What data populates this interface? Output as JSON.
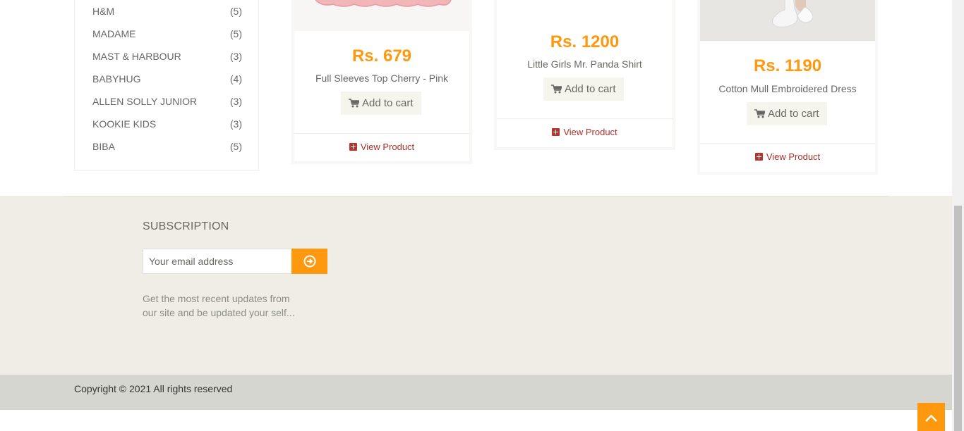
{
  "brands": [
    {
      "name": "H&M",
      "count": "(5)"
    },
    {
      "name": "MADAME",
      "count": "(5)"
    },
    {
      "name": "MAST & HARBOUR",
      "count": "(3)"
    },
    {
      "name": "BABYHUG",
      "count": "(4)"
    },
    {
      "name": "ALLEN SOLLY JUNIOR",
      "count": "(3)"
    },
    {
      "name": "KOOKIE KIDS",
      "count": "(3)"
    },
    {
      "name": "BIBA",
      "count": "(5)"
    }
  ],
  "products": [
    {
      "price": "Rs. 679",
      "name": "Full Sleeves Top Cherry - Pink",
      "add_to_cart": "Add to cart",
      "view_product": "View Product"
    },
    {
      "price": "Rs. 1200",
      "name": "Little Girls Mr. Panda Shirt",
      "add_to_cart": "Add to cart",
      "view_product": "View Product"
    },
    {
      "price": "Rs. 1190",
      "name": "Cotton Mull Embroidered Dress",
      "add_to_cart": "Add to cart",
      "view_product": "View Product"
    }
  ],
  "subscription": {
    "title": "SUBSCRIPTION",
    "email_placeholder": "Your email address",
    "description": "Get the most recent updates from our site and be updated your self..."
  },
  "footer": {
    "copyright": "Copyright © 2021 All rights reserved"
  },
  "colors": {
    "accent": "#fe980f",
    "link": "#a9312b"
  }
}
